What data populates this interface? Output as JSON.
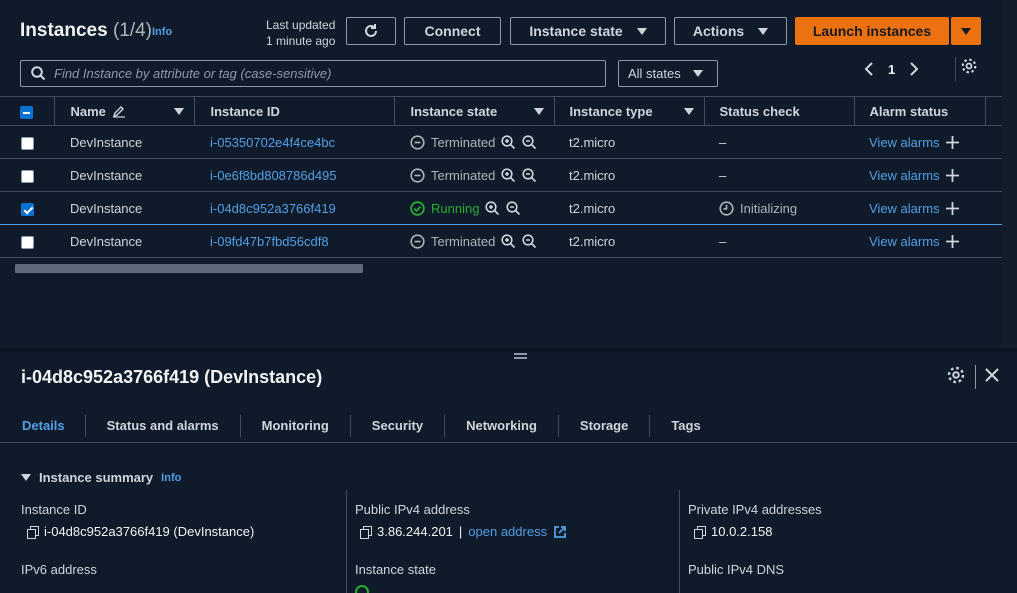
{
  "header": {
    "title": "Instances",
    "count": "(1/4)",
    "info_label": "Info",
    "last_updated_line1": "Last updated",
    "last_updated_line2": "1 minute ago",
    "connect_label": "Connect",
    "instance_state_label": "Instance state",
    "actions_label": "Actions",
    "launch_label": "Launch instances"
  },
  "filter": {
    "search_placeholder": "Find Instance by attribute or tag (case-sensitive)",
    "state_filter": "All states",
    "page": "1"
  },
  "table": {
    "columns": [
      "Name",
      "Instance ID",
      "Instance state",
      "Instance type",
      "Status check",
      "Alarm status"
    ],
    "rows": [
      {
        "name": "DevInstance",
        "id": "i-05350702e4f4ce4bc",
        "state": "Terminated",
        "type": "t2.micro",
        "status": "–",
        "alarm": "View alarms",
        "selected": false
      },
      {
        "name": "DevInstance",
        "id": "i-0e6f8bd808786d495",
        "state": "Terminated",
        "type": "t2.micro",
        "status": "–",
        "alarm": "View alarms",
        "selected": false
      },
      {
        "name": "DevInstance",
        "id": "i-04d8c952a3766f419",
        "state": "Running",
        "type": "t2.micro",
        "status": "Initializing",
        "alarm": "View alarms",
        "selected": true
      },
      {
        "name": "DevInstance",
        "id": "i-09fd47b7fbd56cdf8",
        "state": "Terminated",
        "type": "t2.micro",
        "status": "–",
        "alarm": "View alarms",
        "selected": false
      }
    ]
  },
  "detail": {
    "title": "i-04d8c952a3766f419 (DevInstance)",
    "tabs": [
      "Details",
      "Status and alarms",
      "Monitoring",
      "Security",
      "Networking",
      "Storage",
      "Tags"
    ],
    "active_tab": "Details",
    "summary_label": "Instance summary",
    "fields": {
      "instance_id_label": "Instance ID",
      "instance_id_value": "i-04d8c952a3766f419 (DevInstance)",
      "ipv6_label": "IPv6 address",
      "public_ipv4_label": "Public IPv4 address",
      "public_ipv4_value": "3.86.244.201",
      "open_address": "open address",
      "instance_state_label": "Instance state",
      "private_ipv4_label": "Private IPv4 addresses",
      "private_ipv4_value": "10.0.2.158",
      "public_dns_label": "Public IPv4 DNS"
    }
  },
  "colors": {
    "background": "#0f1b2a",
    "accent_link": "#539fe5",
    "launch_orange": "#ec7211",
    "running_green": "#29ad32",
    "border": "#414d5c"
  }
}
